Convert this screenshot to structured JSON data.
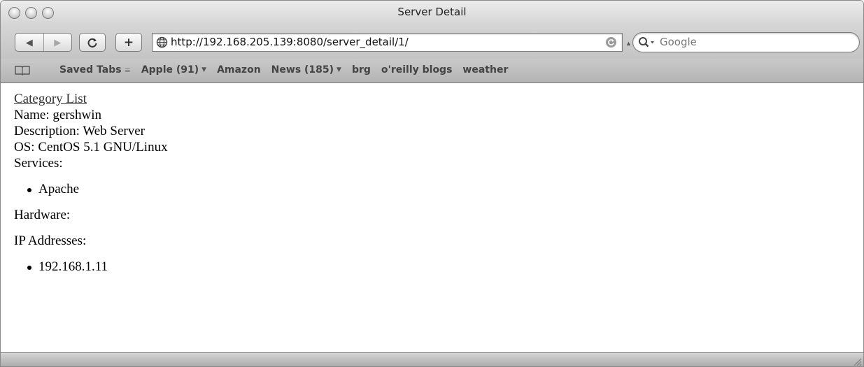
{
  "window": {
    "title": "Server Detail"
  },
  "toolbar": {
    "back_glyph": "◀",
    "forward_glyph": "▶",
    "reload_glyph": "C",
    "add_bookmark_glyph": "+",
    "url": "http://192.168.205.139:8080/server_detail/1/",
    "search_placeholder": "Google"
  },
  "bookmarks": {
    "items": [
      {
        "label": "Saved Tabs",
        "kind": "grip"
      },
      {
        "label": "Apple (91)",
        "kind": "menu"
      },
      {
        "label": "Amazon",
        "kind": "link"
      },
      {
        "label": "News (185)",
        "kind": "menu"
      },
      {
        "label": "brg",
        "kind": "link"
      },
      {
        "label": "o'reilly blogs",
        "kind": "link"
      },
      {
        "label": "weather",
        "kind": "link"
      }
    ]
  },
  "page": {
    "category_link": "Category List",
    "name_line": "Name: gershwin",
    "description_line": "Description: Web Server",
    "os_line": "OS: CentOS 5.1 GNU/Linux",
    "services_label": "Services:",
    "services": [
      "Apache"
    ],
    "hardware_label": "Hardware:",
    "ip_label": "IP Addresses:",
    "ip_addresses": [
      "192.168.1.11"
    ]
  }
}
